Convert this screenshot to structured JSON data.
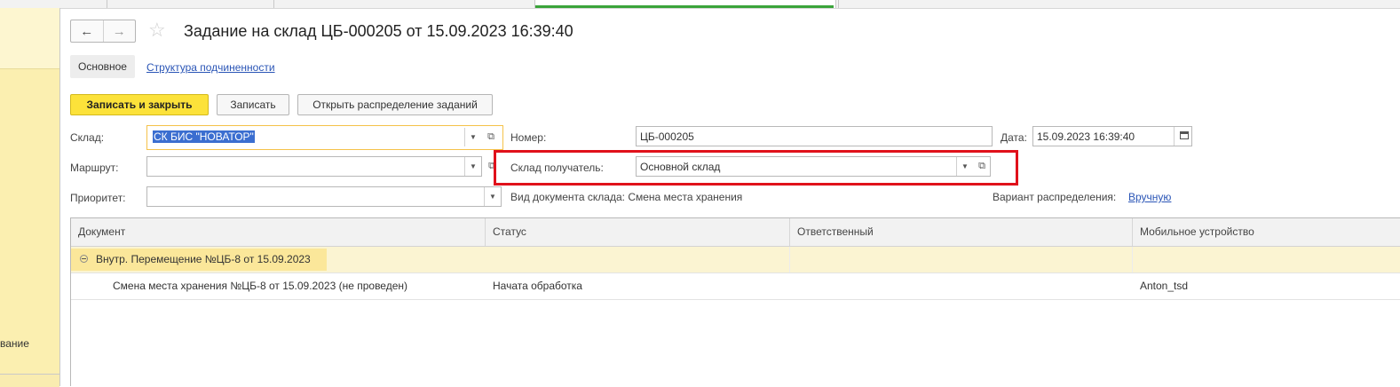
{
  "window": {
    "title": "Задание на склад ЦБ-000205 от 15.09.2023 16:39:40"
  },
  "nav": {
    "back_icon": "arrow-left-icon",
    "forward_icon": "arrow-right-icon",
    "favorite_icon": "star-icon"
  },
  "subnav": {
    "main": "Основное",
    "structure": "Структура подчиненности"
  },
  "toolbar": {
    "save_close": "Записать и закрыть",
    "save": "Записать",
    "open_distribution": "Открыть распределение заданий"
  },
  "form": {
    "sklad_label": "Склад:",
    "sklad_value": "СК БИС \"НОВАТОР\"",
    "route_label": "Маршрут:",
    "route_value": "",
    "priority_label": "Приоритет:",
    "priority_value": "",
    "number_label": "Номер:",
    "number_value": "ЦБ-000205",
    "date_label": "Дата:",
    "date_value": "15.09.2023 16:39:40",
    "receiver_label": "Склад получатель:",
    "receiver_value": "Основной склад",
    "doc_type_label": "Вид документа склада:",
    "doc_type_value": "Смена места хранения",
    "variant_label": "Вариант распределения:",
    "variant_value": "Вручную"
  },
  "table": {
    "headers": [
      "Документ",
      "Статус",
      "Ответственный",
      "Мобильное устройство"
    ],
    "rows": [
      {
        "document": "Внутр. Перемещение №ЦБ-8 от 15.09.2023",
        "status": "",
        "responsible": "",
        "device": ""
      },
      {
        "document": "Смена места хранения №ЦБ-8 от 15.09.2023 (не проведен)",
        "status": "Начата обработка",
        "responsible": "",
        "device": "Anton_tsd"
      }
    ]
  },
  "sidebar": {
    "partial_text": "вание"
  },
  "colors": {
    "primary_button": "#fce23a",
    "highlight_box": "#e0111b",
    "link": "#2a55b6",
    "group_row": "#fbf4d2"
  }
}
